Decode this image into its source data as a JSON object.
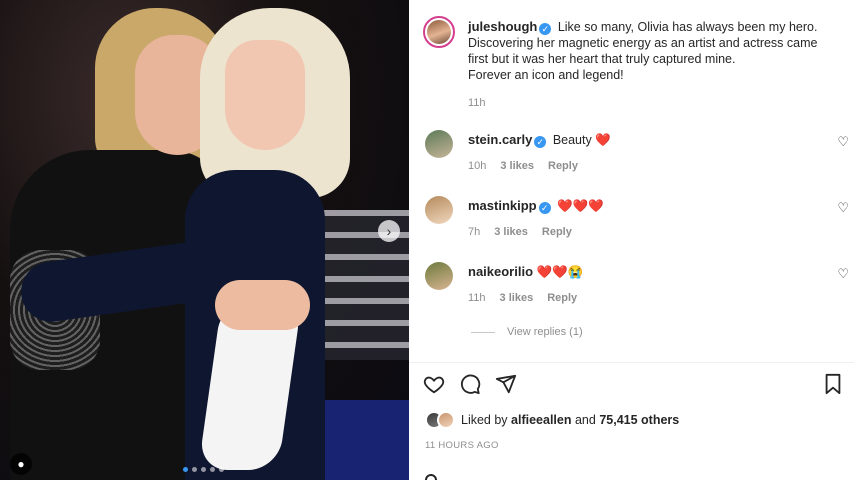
{
  "photo": {
    "next_icon": "chevron-right-icon",
    "tag_icon": "person-icon",
    "carousel": {
      "count": 5,
      "active_index": 0
    }
  },
  "post": {
    "author": "juleshough",
    "caption_lines": [
      "Like so many, Olivia has always been my hero.",
      "Discovering her magnetic energy as an artist and actress came",
      "first but it was her heart that truly captured mine.",
      "Forever an icon and legend!"
    ],
    "time": "11h"
  },
  "comments": [
    {
      "username": "stein.carly",
      "verified": true,
      "text": "Beauty",
      "emoji": "❤️",
      "time": "10h",
      "likes": "3 likes",
      "reply": "Reply"
    },
    {
      "username": "mastinkipp",
      "verified": true,
      "text": "",
      "emoji": "❤️❤️❤️",
      "time": "7h",
      "likes": "3 likes",
      "reply": "Reply"
    },
    {
      "username": "naikeorilio",
      "verified": false,
      "text": "",
      "emoji": "❤️❤️😭",
      "time": "11h",
      "likes": "3 likes",
      "reply": "Reply"
    }
  ],
  "view_replies": "View replies (1)",
  "likes": {
    "prefix": "Liked by",
    "user": "alfieeallen",
    "joiner": "and",
    "count": "75,415 others"
  },
  "post_time": "11 hours ago",
  "colors": {
    "verified": "#3897f0",
    "heart": "#e0102f",
    "muted": "#8e8e8e",
    "ring": "#d43f8d"
  }
}
